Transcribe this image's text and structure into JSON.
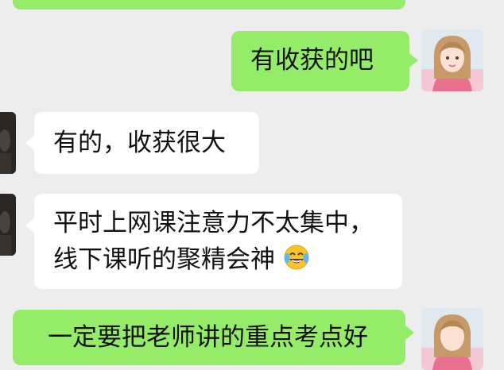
{
  "chat": {
    "messages": [
      {
        "sender": "me",
        "text": ""
      },
      {
        "sender": "me",
        "text": "有收获的吧"
      },
      {
        "sender": "other",
        "text": "有的，收获很大"
      },
      {
        "sender": "other",
        "lines": [
          "平时上网课注意力不太集中，",
          "线下课听的聚精会神"
        ],
        "emoji": "tears-of-joy-emoji"
      },
      {
        "sender": "me",
        "text": "一定要把老师讲的重点考点好"
      }
    ]
  },
  "colors": {
    "background": "#ededed",
    "sent_bubble": "#95ec69",
    "received_bubble": "#ffffff"
  },
  "icons": {
    "my_avatar": "anime-girl-avatar",
    "other_avatar": "dark-photo-avatar"
  }
}
